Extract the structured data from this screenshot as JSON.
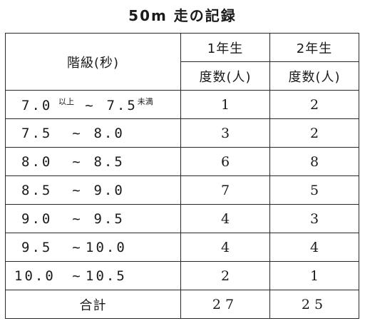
{
  "title": "50m 走の記録",
  "table": {
    "header_class": "階級(秒)",
    "year1_label": "1年生",
    "year2_label": "2年生",
    "count_label_1": "度数(人)",
    "count_label_2": "度数(人)",
    "rows": [
      {
        "lo": "7.0",
        "lo_note": "以上",
        "sep": "~",
        "hi": "7.5",
        "hi_note": "未満",
        "y1": "1",
        "y2": "2"
      },
      {
        "lo": "7.5",
        "sep": "~",
        "hi": "8.0",
        "y1": "3",
        "y2": "2"
      },
      {
        "lo": "8.0",
        "sep": "~",
        "hi": "8.5",
        "y1": "6",
        "y2": "8"
      },
      {
        "lo": "8.5",
        "sep": "~",
        "hi": "9.0",
        "y1": "7",
        "y2": "5"
      },
      {
        "lo": "9.0",
        "sep": "~",
        "hi": "9.5",
        "y1": "4",
        "y2": "3"
      },
      {
        "lo": "9.5",
        "sep": "~",
        "hi": "10.0",
        "y1": "4",
        "y2": "4"
      },
      {
        "lo": "10.0",
        "sep": "~",
        "hi": "10.5",
        "y1": "2",
        "y2": "1"
      }
    ],
    "total_label": "合計",
    "total_y1": "27",
    "total_y2": "25"
  }
}
